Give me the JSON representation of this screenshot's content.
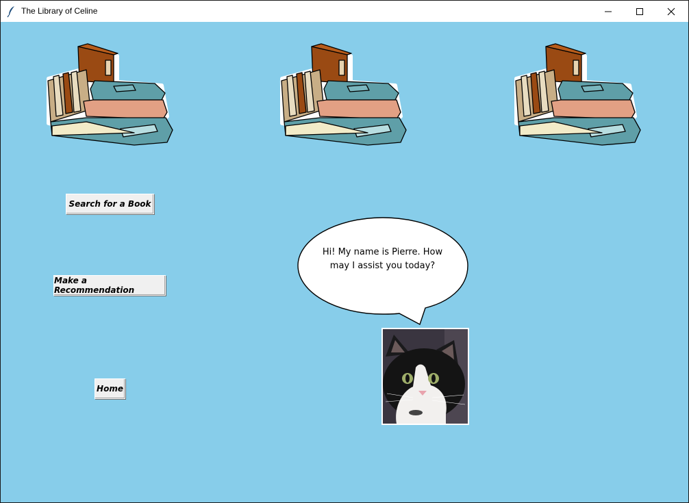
{
  "window": {
    "title": "The Library of Celine",
    "controls": [
      "minimize-icon",
      "maximize-icon",
      "close-icon"
    ]
  },
  "colors": {
    "background": "#87cdea",
    "button_face": "#f0f0f0"
  },
  "buttons": {
    "search": "Search for a Book",
    "recommend": "Make a Recommendation",
    "home": "Home"
  },
  "speech_bubble": {
    "text": "Hi! My name is Pierre. How may I assist you today?"
  },
  "images": {
    "books": "stack-of-books-icon",
    "mascot": "cat-photo"
  }
}
